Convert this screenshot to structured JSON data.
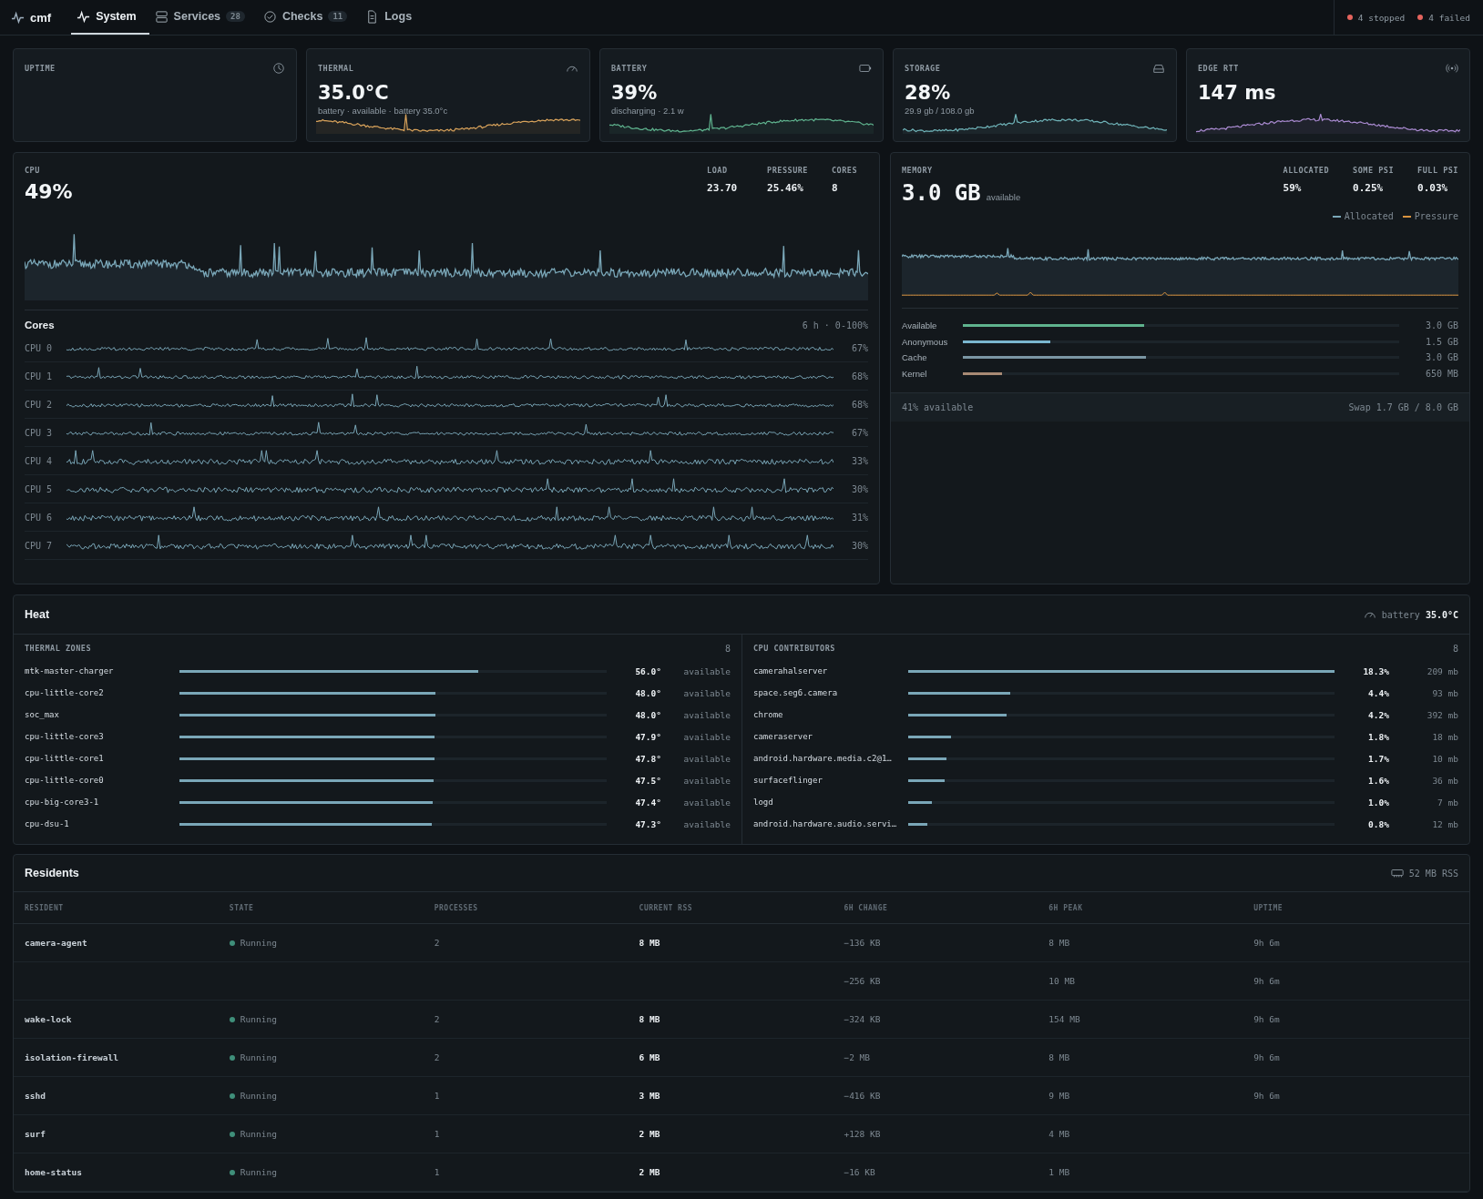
{
  "nav": {
    "brand": "cmf",
    "tabs": [
      {
        "label": "System",
        "selected": true
      },
      {
        "label": "Services",
        "badge": "28",
        "selected": false
      },
      {
        "label": "Checks",
        "badge": "11",
        "selected": false
      },
      {
        "label": "Logs",
        "selected": false
      }
    ],
    "status": [
      "4 stopped",
      "4 failed"
    ]
  },
  "cards": [
    {
      "label": "UPTIME"
    },
    {
      "label": "THERMAL",
      "value": "35.0°C",
      "sub": "battery · available · battery 35.0°c"
    },
    {
      "label": "BATTERY",
      "value": "39%",
      "sub": "discharging · 2.1 w"
    },
    {
      "label": "STORAGE",
      "value": "28%",
      "sub": "29.9 gb / 108.0 gb"
    },
    {
      "label": "EDGE RTT",
      "value": "147 ms"
    }
  ],
  "cpu": {
    "label": "CPU",
    "value": "49%",
    "stats": [
      {
        "label": "LOAD",
        "value": "23.70"
      },
      {
        "label": "PRESSURE",
        "value": "25.46%"
      },
      {
        "label": "CORES",
        "value": "8"
      }
    ],
    "cores_title": "Cores",
    "cores_range": "6 h · 0-100%",
    "cores": [
      {
        "name": "CPU 0",
        "reading": "67%"
      },
      {
        "name": "CPU 1",
        "reading": "68%"
      },
      {
        "name": "CPU 2",
        "reading": "68%"
      },
      {
        "name": "CPU 3",
        "reading": "67%"
      },
      {
        "name": "CPU 4",
        "reading": "33%"
      },
      {
        "name": "CPU 5",
        "reading": "30%"
      },
      {
        "name": "CPU 6",
        "reading": "31%"
      },
      {
        "name": "CPU 7",
        "reading": "30%"
      }
    ]
  },
  "memory": {
    "label": "MEMORY",
    "value": "3.0 GB",
    "unit": "available",
    "stats": [
      {
        "label": "ALLOCATED",
        "value": "59%"
      },
      {
        "label": "SOME PSI",
        "value": "0.25%"
      },
      {
        "label": "FULL PSI",
        "value": "0.03%"
      }
    ],
    "legend": [
      "Allocated",
      "Pressure"
    ],
    "bars": [
      {
        "name": "Available",
        "level": 0.415,
        "reading": "3.0 GB"
      },
      {
        "name": "Anonymous",
        "level": 0.2,
        "reading": "1.5 GB"
      },
      {
        "name": "Cache",
        "level": 0.42,
        "reading": "3.0 GB"
      },
      {
        "name": "Kernel",
        "level": 0.09,
        "reading": "650 MB"
      }
    ],
    "footer_left": "41% available",
    "footer_right": "Swap 1.7 GB / 8.0 GB"
  },
  "heat": {
    "title": "Heat",
    "sensor": "battery",
    "sensor_value": "35.0°C",
    "zones": {
      "title": "THERMAL ZONES",
      "count": "8",
      "rows": [
        {
          "name": "mtk-master-charger",
          "level": 0.7,
          "reading": "56.0°",
          "status": "available"
        },
        {
          "name": "cpu-little-core2",
          "level": 0.6,
          "reading": "48.0°",
          "status": "available"
        },
        {
          "name": "soc_max",
          "level": 0.6,
          "reading": "48.0°",
          "status": "available"
        },
        {
          "name": "cpu-little-core3",
          "level": 0.598,
          "reading": "47.9°",
          "status": "available"
        },
        {
          "name": "cpu-little-core1",
          "level": 0.596,
          "reading": "47.8°",
          "status": "available"
        },
        {
          "name": "cpu-little-core0",
          "level": 0.594,
          "reading": "47.5°",
          "status": "available"
        },
        {
          "name": "cpu-big-core3-1",
          "level": 0.592,
          "reading": "47.4°",
          "status": "available"
        },
        {
          "name": "cpu-dsu-1",
          "level": 0.591,
          "reading": "47.3°",
          "status": "available"
        }
      ]
    },
    "contributors": {
      "title": "CPU CONTRIBUTORS",
      "count": "8",
      "rows": [
        {
          "name": "camerahalserver",
          "level": 1.0,
          "reading": "18.3%",
          "mem": "209 mb"
        },
        {
          "name": "space.seg6.camera",
          "level": 0.24,
          "reading": "4.4%",
          "mem": "93 mb"
        },
        {
          "name": "chrome",
          "level": 0.23,
          "reading": "4.2%",
          "mem": "392 mb"
        },
        {
          "name": "cameraserver",
          "level": 0.1,
          "reading": "1.8%",
          "mem": "18 mb"
        },
        {
          "name": "android.hardware.media.c2@1…",
          "level": 0.09,
          "reading": "1.7%",
          "mem": "10 mb"
        },
        {
          "name": "surfaceflinger",
          "level": 0.085,
          "reading": "1.6%",
          "mem": "36 mb"
        },
        {
          "name": "logd",
          "level": 0.055,
          "reading": "1.0%",
          "mem": "7 mb"
        },
        {
          "name": "android.hardware.audio.servi…",
          "level": 0.045,
          "reading": "0.8%",
          "mem": "12 mb"
        }
      ]
    }
  },
  "residents": {
    "title": "Residents",
    "total": "52 MB RSS",
    "columns": [
      "RESIDENT",
      "STATE",
      "PROCESSES",
      "CURRENT RSS",
      "6H CHANGE",
      "6H PEAK",
      "UPTIME"
    ],
    "rows": [
      {
        "cells": [
          "camera-agent",
          "Running",
          "2",
          "8 MB",
          "−136 KB",
          "8 MB",
          "9h 6m"
        ]
      },
      {
        "cells": [
          "",
          "",
          "",
          "",
          "−256 KB",
          "10 MB",
          "9h 6m"
        ]
      },
      {
        "cells": [
          "wake-lock",
          "Running",
          "2",
          "8 MB",
          "−324 KB",
          "154 MB",
          "9h 6m"
        ]
      },
      {
        "cells": [
          "isolation-firewall",
          "Running",
          "2",
          "6 MB",
          "−2 MB",
          "8 MB",
          "9h 6m"
        ]
      },
      {
        "cells": [
          "sshd",
          "Running",
          "1",
          "3 MB",
          "−416 KB",
          "9 MB",
          "9h 6m"
        ]
      },
      {
        "cells": [
          "surf",
          "Running",
          "1",
          "2 MB",
          "+128 KB",
          "4 MB",
          ""
        ]
      },
      {
        "cells": [
          "home-status",
          "Running",
          "1",
          "2 MB",
          "−16 KB",
          "1 MB",
          ""
        ]
      }
    ]
  }
}
